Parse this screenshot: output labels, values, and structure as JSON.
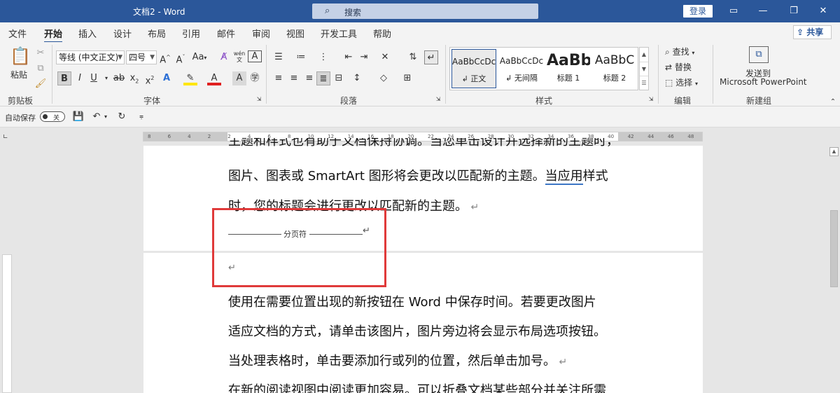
{
  "window": {
    "title": "文档2  -  Word",
    "search_placeholder": "搜索",
    "login": "登录",
    "controls": {
      "ribbon_display": "▭",
      "minimize": "—",
      "restore": "❐",
      "close": "✕"
    }
  },
  "tabs": [
    "文件",
    "开始",
    "插入",
    "设计",
    "布局",
    "引用",
    "邮件",
    "审阅",
    "视图",
    "开发工具",
    "帮助"
  ],
  "active_tab": "开始",
  "share": "共享",
  "ribbon": {
    "clipboard": {
      "paste": "粘贴",
      "label": "剪贴板"
    },
    "font": {
      "family": "等线 (中文正文)",
      "size": "四号",
      "grow": "A^",
      "shrink": "Aˇ",
      "case": "Aa",
      "label": "字体"
    },
    "paragraph": {
      "label": "段落"
    },
    "styles": {
      "label": "样式",
      "items": [
        {
          "sample": "AaBbCcDc",
          "name": "正文"
        },
        {
          "sample": "AaBbCcDc",
          "name": "无间隔"
        },
        {
          "sample": "AaBb",
          "name": "标题 1"
        },
        {
          "sample": "AaBbC",
          "name": "标题 2"
        }
      ]
    },
    "editing": {
      "find": "查找",
      "replace": "替换",
      "select": "选择",
      "label": "编辑"
    },
    "newgroup": {
      "send_line1": "发送到",
      "send_line2": "Microsoft PowerPoint",
      "label": "新建组"
    }
  },
  "qat": {
    "autosave": "自动保存",
    "toggle": "关"
  },
  "ruler_ticks": [
    "8",
    "6",
    "4",
    "2",
    "2",
    "4",
    "6",
    "8",
    "10",
    "12",
    "14",
    "16",
    "18",
    "20",
    "22",
    "24",
    "26",
    "28",
    "30",
    "32",
    "34",
    "36",
    "38",
    "40",
    "42",
    "44",
    "46",
    "48"
  ],
  "document": {
    "line_top": "主题和样式也有助于文档保持协调。当您单击设计并选择新的主题时，",
    "line1": "图片、图表或 SmartArt 图形将会更改以匹配新的主题。",
    "line1_spell": "当应用",
    "line1_end": "样式",
    "line2": "时，您的标题会进行更改以匹配新的主题。",
    "page_break_label": "分页符",
    "line3": "使用在需要位置出现的新按钮在 Word 中保存时间。若要更改图片",
    "line4": "适应文档的方式，请单击该图片，图片旁边将会显示布局选项按钮。",
    "line5": "当处理表格时，单击要添加行或列的位置，然后单击加号。",
    "line6": "在新的阅读视图中阅读更加容易。可以折叠文档某些部分并关注所需"
  }
}
